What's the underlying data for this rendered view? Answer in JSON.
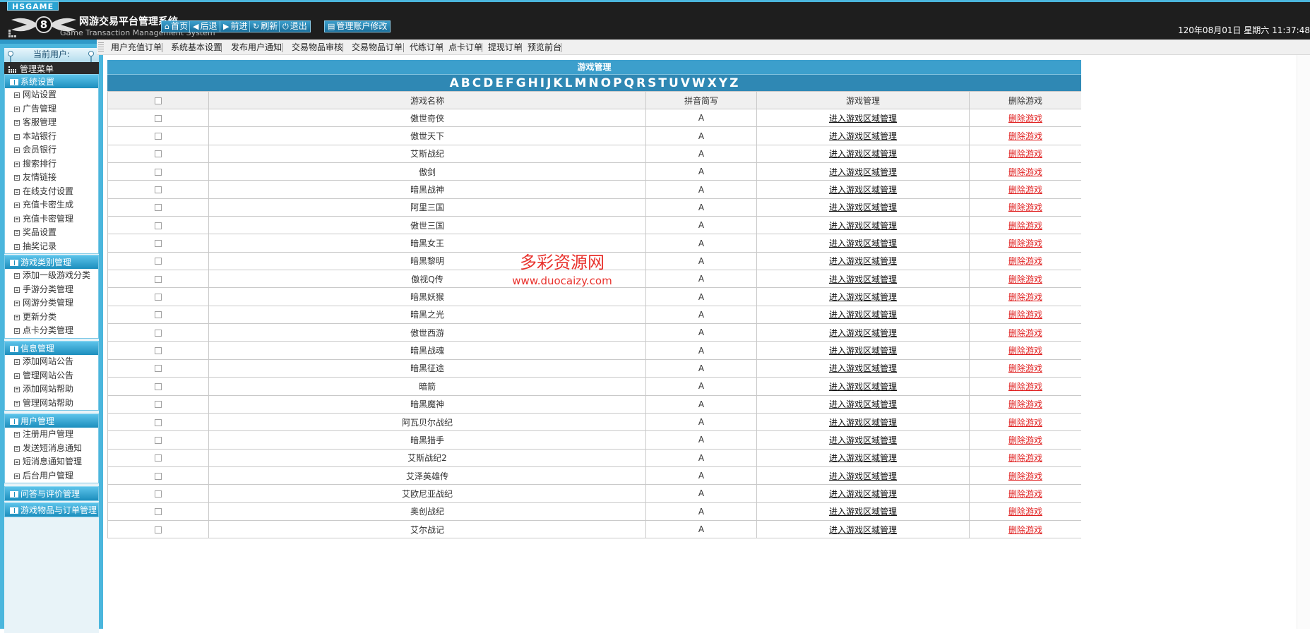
{
  "header": {
    "brand_badge": "HSGAME",
    "title": "网游交易平台管理系统",
    "subtitle": "Game Transaction Management System",
    "datetime": "120年08月01日 星期六 11:37:48",
    "toolbar": [
      {
        "label": "首页",
        "icon": "home-icon"
      },
      {
        "label": "后退",
        "icon": "arrow-left-icon"
      },
      {
        "label": "前进",
        "icon": "arrow-right-icon"
      },
      {
        "label": "刷新",
        "icon": "refresh-icon"
      },
      {
        "label": "退出",
        "icon": "power-icon"
      },
      {
        "label": "管理账户修改",
        "icon": "account-icon"
      }
    ]
  },
  "sidebar": {
    "current_user_label": "当前用户:",
    "menu_title": "管理菜单",
    "groups": [
      {
        "title": "系统设置",
        "items": [
          "网站设置",
          "广告管理",
          "客服管理",
          "本站银行",
          "会员银行",
          "搜索排行",
          "友情链接",
          "在线支付设置",
          "充值卡密生成",
          "充值卡密管理",
          "奖品设置",
          "抽奖记录"
        ]
      },
      {
        "title": "游戏类别管理",
        "items": [
          "添加一级游戏分类",
          "手游分类管理",
          "网游分类管理",
          "更新分类",
          "点卡分类管理"
        ]
      },
      {
        "title": "信息管理",
        "items": [
          "添加网站公告",
          "管理网站公告",
          "添加网站帮助",
          "管理网站帮助"
        ]
      },
      {
        "title": "用户管理",
        "items": [
          "注册用户管理",
          "发送短消息通知",
          "短消息通知管理",
          "后台用户管理"
        ]
      },
      {
        "title": "问答与评价管理",
        "items": []
      },
      {
        "title": "游戏物品与订单管理",
        "items": []
      }
    ]
  },
  "nav": [
    "用户充值订单",
    "系统基本设置",
    "发布用户通知",
    "交易物品审核",
    "交易物品订单",
    "代练订单",
    "点卡订单",
    "提现订单",
    "预览前台"
  ],
  "table": {
    "title": "游戏管理",
    "letters": [
      "A",
      "B",
      "C",
      "D",
      "E",
      "F",
      "G",
      "H",
      "I",
      "J",
      "K",
      "L",
      "M",
      "N",
      "O",
      "P",
      "Q",
      "R",
      "S",
      "T",
      "U",
      "V",
      "W",
      "X",
      "Y",
      "Z"
    ],
    "columns": [
      "",
      "游戏名称",
      "拼音简写",
      "游戏管理",
      "删除游戏"
    ],
    "manage_link": "进入游戏区域管理",
    "delete_link": "删除游戏",
    "rows": [
      {
        "name": "傲世奇侠",
        "pinyin": "A"
      },
      {
        "name": "傲世天下",
        "pinyin": "A"
      },
      {
        "name": "艾斯战纪",
        "pinyin": "A"
      },
      {
        "name": "傲剑",
        "pinyin": "A"
      },
      {
        "name": "暗黑战神",
        "pinyin": "A"
      },
      {
        "name": "阿里三国",
        "pinyin": "A"
      },
      {
        "name": "傲世三国",
        "pinyin": "A"
      },
      {
        "name": "暗黑女王",
        "pinyin": "A"
      },
      {
        "name": "暗黑黎明",
        "pinyin": "A"
      },
      {
        "name": "傲视Q传",
        "pinyin": "A"
      },
      {
        "name": "暗黑妖猴",
        "pinyin": "A"
      },
      {
        "name": "暗黑之光",
        "pinyin": "A"
      },
      {
        "name": "傲世西游",
        "pinyin": "A"
      },
      {
        "name": "暗黑战魂",
        "pinyin": "A"
      },
      {
        "name": "暗黑征途",
        "pinyin": "A"
      },
      {
        "name": "暗箭",
        "pinyin": "A"
      },
      {
        "name": "暗黑魔神",
        "pinyin": "A"
      },
      {
        "name": "阿瓦贝尔战纪",
        "pinyin": "A"
      },
      {
        "name": "暗黑猎手",
        "pinyin": "A"
      },
      {
        "name": "艾斯战纪2",
        "pinyin": "A"
      },
      {
        "name": "艾泽英雄传",
        "pinyin": "A"
      },
      {
        "name": "艾欧尼亚战纪",
        "pinyin": "A"
      },
      {
        "name": "奥创战纪",
        "pinyin": "A"
      },
      {
        "name": "艾尔战记",
        "pinyin": "A"
      }
    ]
  },
  "watermark": {
    "line1": "多彩资源网",
    "line2": "www.duocaizy.com"
  }
}
